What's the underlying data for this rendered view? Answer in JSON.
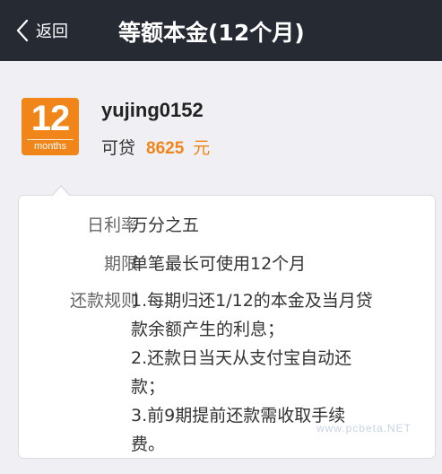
{
  "nav": {
    "back_label": "返回",
    "title": "等额本金(12个月)"
  },
  "account": {
    "logo_number": "12",
    "logo_caption": "months",
    "username": "yujing0152",
    "credit_label": "可贷",
    "credit_amount": "8625",
    "credit_unit": "元"
  },
  "details": {
    "daily_rate_label": "日利率",
    "daily_rate_value": "万分之五",
    "term_label": "期限",
    "term_value": "单笔最长可使用12个月",
    "rules_label": "还款规则",
    "rules_lines": [
      "1.每期归还1/12的本金及当月贷",
      "款余额产生的利息；",
      "2.还款日当天从支付宝自动还",
      "款；",
      "3.前9期提前还款需收取手续",
      "费。"
    ]
  },
  "watermark": "www.pcbeta.NET",
  "colors": {
    "navbar": "#262a33",
    "accent": "#f08519",
    "background": "#efeff4"
  },
  "icons": {
    "back": "chevron-left-icon"
  }
}
